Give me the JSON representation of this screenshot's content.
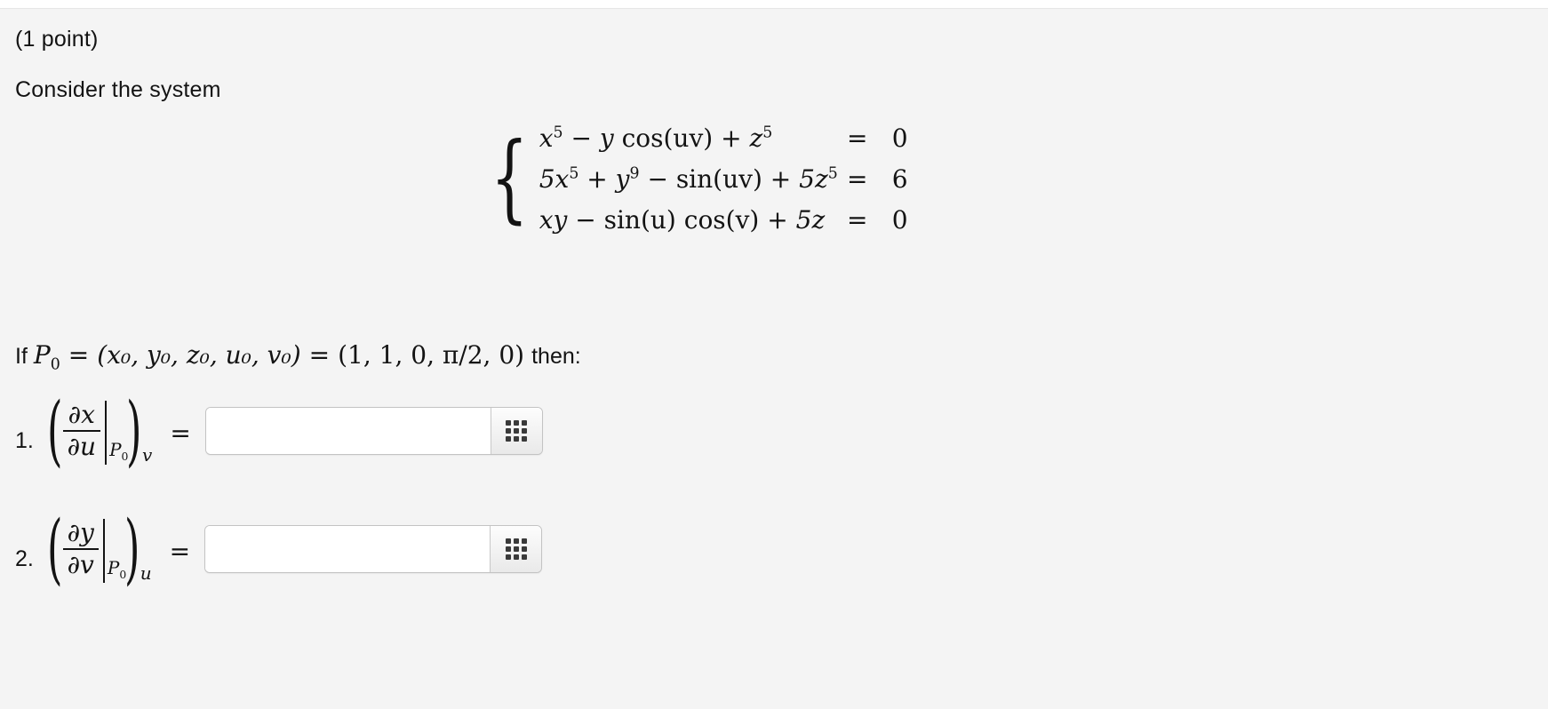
{
  "header": {
    "points_label": "(1 point)",
    "prompt": "Consider the system"
  },
  "system": {
    "open_brace": "{",
    "equations": [
      {
        "lhs_parts": {
          "t1": "x",
          "t1_exp": "5",
          "op1": "−",
          "t2": "y",
          "t2_fn": "cos(uv)",
          "op2": "+",
          "t3": "z",
          "t3_exp": "5"
        },
        "relation": "=",
        "rhs": "0"
      },
      {
        "lhs_parts": {
          "t1": "5x",
          "t1_exp": "5",
          "op1": "+",
          "t2": "y",
          "t2_exp": "9",
          "op2": "−",
          "t3": "sin(uv)",
          "op3": "+",
          "t4": "5z",
          "t4_exp": "5"
        },
        "relation": "=",
        "rhs": "6"
      },
      {
        "lhs_parts": {
          "t1": "xy",
          "op1": "−",
          "t2": "sin(u)",
          "t3": "cos(v)",
          "op2": "+",
          "t4": "5z"
        },
        "relation": "=",
        "rhs": "0"
      }
    ]
  },
  "point_line": {
    "lead": "If",
    "point_symbol": "P",
    "point_subscript": "0",
    "equals_1": "=",
    "coords_symbolic": "(x₀, y₀, z₀, u₀, v₀)",
    "equals_2": "=",
    "coords_numeric": "(1, 1, 0, π/2, 0)",
    "tail": "then:"
  },
  "items": [
    {
      "number": "1.",
      "numerator": "∂x",
      "denominator": "∂u",
      "eval_point": "P",
      "eval_point_sub": "0",
      "held_constant": "v",
      "equals": "=",
      "answer_value": "",
      "answer_placeholder": "",
      "keypad_icon": "grid-3x3-icon"
    },
    {
      "number": "2.",
      "numerator": "∂y",
      "denominator": "∂v",
      "eval_point": "P",
      "eval_point_sub": "0",
      "held_constant": "u",
      "equals": "=",
      "answer_value": "",
      "answer_placeholder": "",
      "keypad_icon": "grid-3x3-icon"
    }
  ],
  "colors": {
    "page_background": "#f4f4f4",
    "text": "#131313",
    "input_background": "#ffffff",
    "input_border": "#c3c3c3",
    "icon_dark": "#3a3a3a"
  }
}
